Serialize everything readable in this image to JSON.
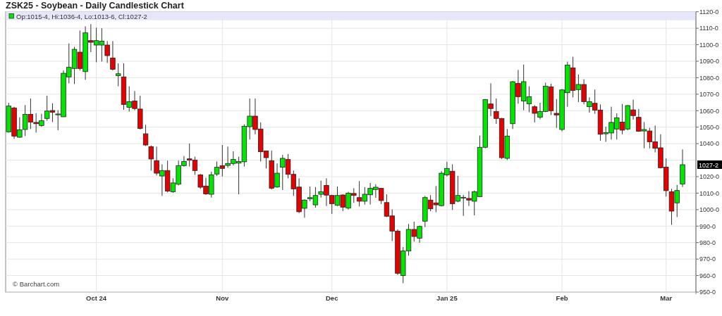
{
  "title": "ZSK25 - Soybean - Daily Candlestick Chart",
  "legend": "Op:1015-4, Hi:1036-4, Lo:1013-6, Cl:1027-2",
  "credit": "© Barchart.com",
  "y_axis_labels": [
    "1120-0",
    "1110-0",
    "1100-0",
    "1090-0",
    "1080-0",
    "1070-0",
    "1060-0",
    "1050-0",
    "1040-0",
    "1020-0",
    "1010-0",
    "1000-0",
    "990-0",
    "980-0",
    "970-0",
    "960-0",
    "950-0"
  ],
  "x_axis_labels": [
    "Oct 24",
    "Nov",
    "Dec",
    "Jan 25",
    "Feb",
    "Mar"
  ],
  "last_price_label": "1027-2"
}
